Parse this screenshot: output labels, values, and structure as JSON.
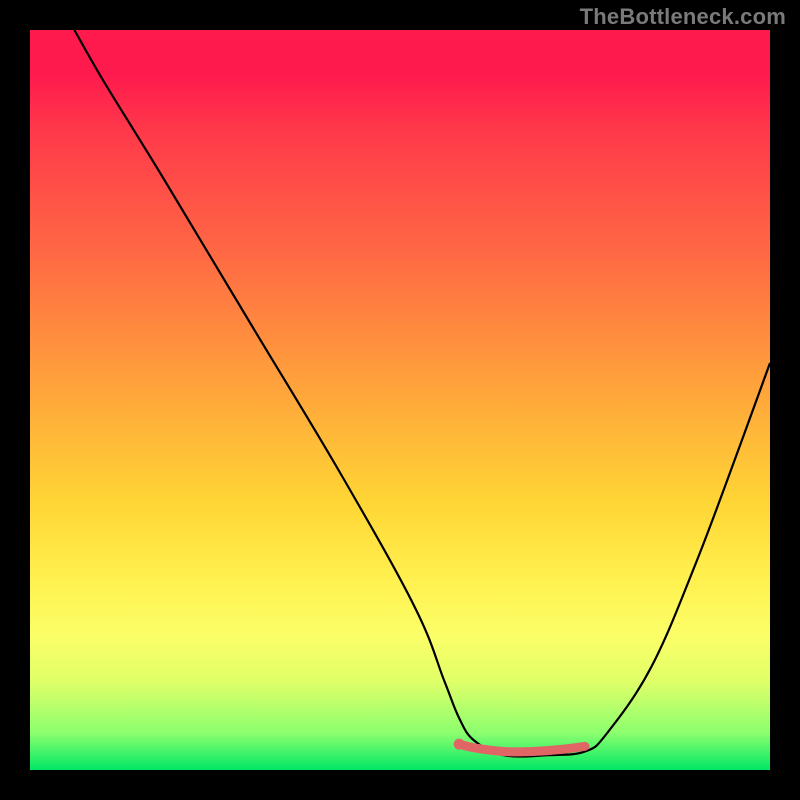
{
  "watermark": "TheBottleneck.com",
  "chart_data": {
    "type": "line",
    "title": "",
    "xlabel": "",
    "ylabel": "",
    "xlim": [
      0,
      100
    ],
    "ylim": [
      0,
      100
    ],
    "series": [
      {
        "name": "curve",
        "color": "#000000",
        "x": [
          6,
          10,
          18,
          30,
          42,
          52,
          56,
          58,
          60,
          64,
          70,
          75,
          78,
          84,
          90,
          96,
          100
        ],
        "y": [
          100,
          93,
          80,
          60,
          40,
          22,
          12,
          7,
          4,
          2,
          2,
          2.5,
          5,
          14,
          28,
          44,
          55
        ]
      },
      {
        "name": "low-bottleneck-band",
        "color": "#e06666",
        "x": [
          58,
          60,
          64,
          68,
          72,
          75
        ],
        "y": [
          3.5,
          3,
          2.5,
          2.5,
          2.8,
          3.2
        ]
      }
    ],
    "background_gradient": {
      "orientation": "vertical",
      "stops": [
        {
          "pos": 0.0,
          "color": "#ff1a4d"
        },
        {
          "pos": 0.3,
          "color": "#ff6844"
        },
        {
          "pos": 0.55,
          "color": "#ffb639"
        },
        {
          "pos": 0.75,
          "color": "#fff04e"
        },
        {
          "pos": 0.9,
          "color": "#c9ff68"
        },
        {
          "pos": 1.0,
          "color": "#00e765"
        }
      ]
    }
  }
}
